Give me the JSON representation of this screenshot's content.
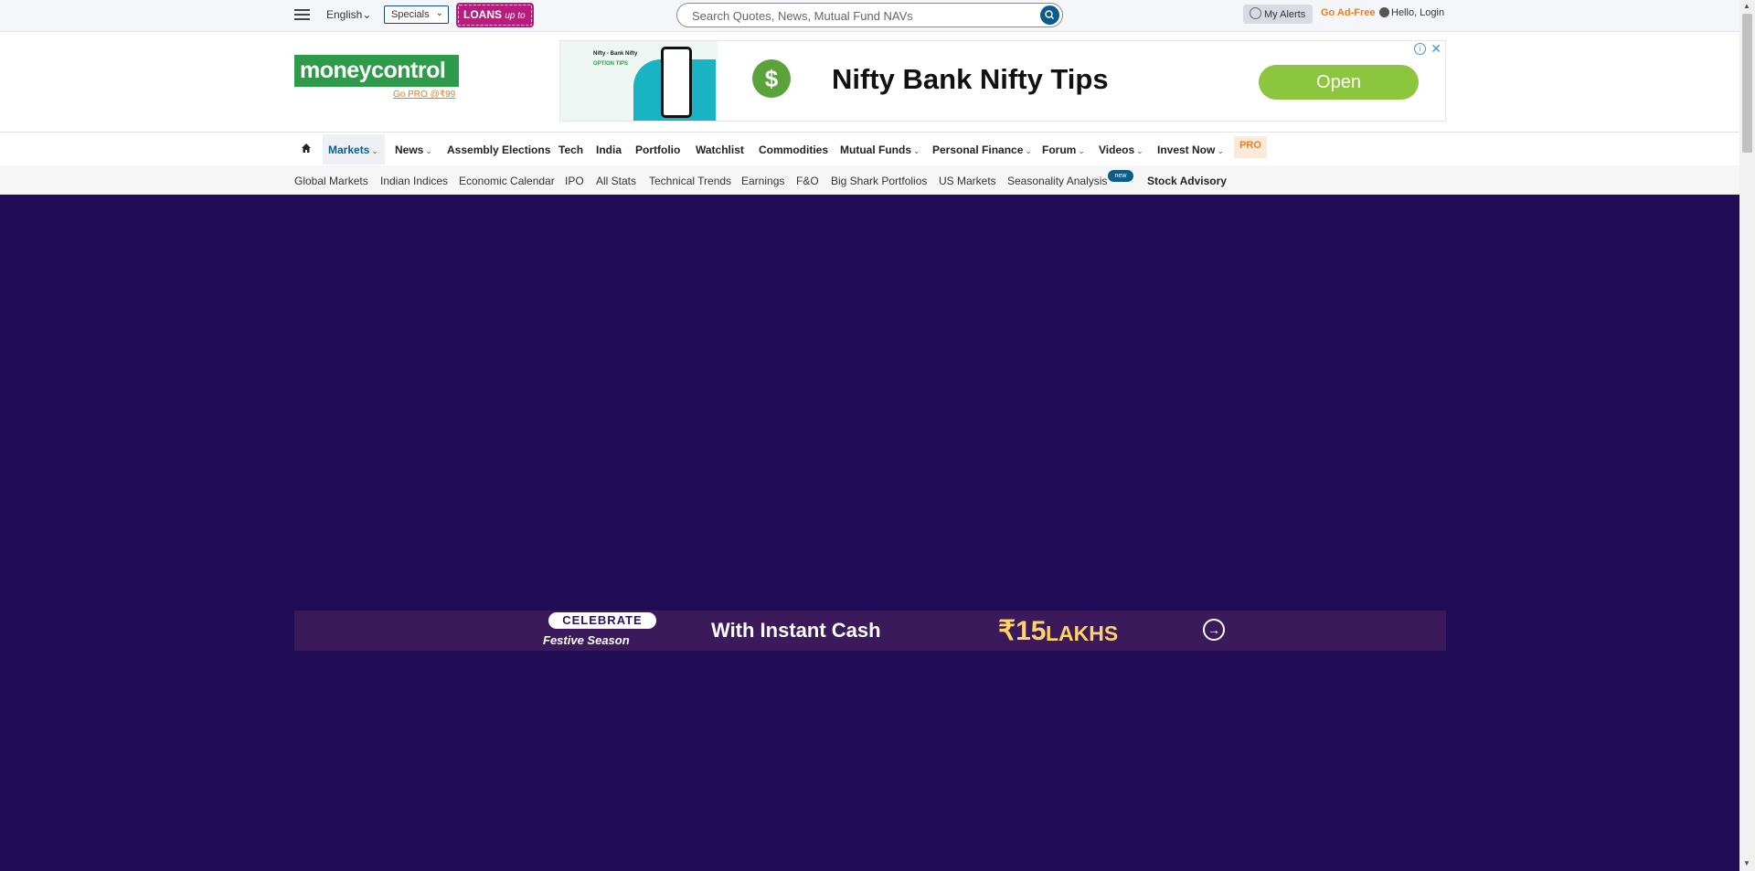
{
  "topbar": {
    "language": "English",
    "language_chevron": "⌄",
    "specials": "Specials",
    "specials_chevron": "⌄",
    "loans": "LOANS",
    "loans_suffix": "up to",
    "search_placeholder": "Search Quotes, News, Mutual Fund NAVs",
    "my_alerts": "My Alerts",
    "go_ad_free": "Go Ad-Free",
    "login": "Hello, Login"
  },
  "header": {
    "logo_text": "moneycontrol",
    "go_pro": "Go PRO @₹99"
  },
  "ad": {
    "thumb_title": "Nifty - Bank Nifty",
    "thumb_subtitle": "OPTION TIPS",
    "headline": "Nifty Bank Nifty Tips",
    "cta": "Open",
    "info": "i",
    "close": "✕"
  },
  "nav": {
    "items": [
      {
        "label": "Markets",
        "chevron": "⌄"
      },
      {
        "label": "News",
        "chevron": "⌄"
      },
      {
        "label": "Assembly Elections"
      },
      {
        "label": "Tech"
      },
      {
        "label": "India"
      },
      {
        "label": "Portfolio"
      },
      {
        "label": "Watchlist"
      },
      {
        "label": "Commodities"
      },
      {
        "label": "Mutual Funds",
        "chevron": "⌄"
      },
      {
        "label": "Personal Finance",
        "chevron": "⌄"
      },
      {
        "label": "Forum",
        "chevron": "⌄"
      },
      {
        "label": "Videos",
        "chevron": "⌄"
      },
      {
        "label": "Invest Now",
        "chevron": "⌄"
      }
    ],
    "pro": "PRO"
  },
  "subnav": {
    "items": [
      "Global Markets",
      "Indian Indices",
      "Economic Calendar",
      "IPO",
      "All Stats",
      "Technical Trends",
      "Earnings",
      "F&O",
      "Big Shark Portfolios",
      "US Markets",
      "Seasonality Analysis",
      "Stock Advisory"
    ],
    "new_badge": "new"
  },
  "banner": {
    "celebrate": "CELEBRATE",
    "festive": "Festive Season",
    "cash": "With Instant Cash",
    "amount": "₹15",
    "lakhs": "LAKHS",
    "arrow": "→"
  },
  "colors": {
    "background": "#1f0c55",
    "brand_green": "#2e9b4a",
    "accent_blue": "#0a5d8a",
    "accent_orange": "#e67e22",
    "loans_pink": "#b51e7c"
  },
  "icons": [
    "hamburger-menu-icon",
    "search-icon",
    "bell-icon",
    "user-icon",
    "home-icon",
    "chevron-down-icon",
    "info-icon",
    "close-icon",
    "arrow-right-icon"
  ]
}
